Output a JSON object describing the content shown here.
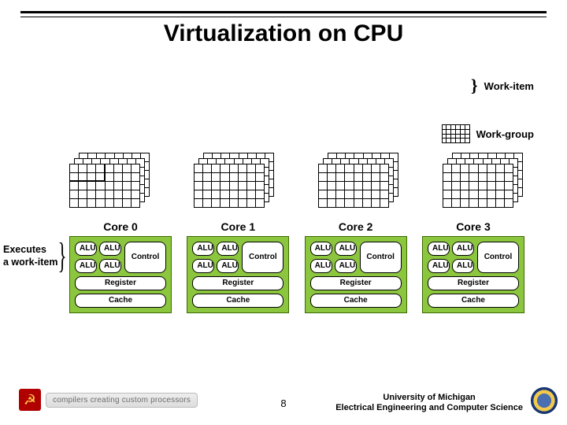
{
  "title": "Virtualization on CPU",
  "legend": {
    "work_item": "Work-item",
    "work_group": "Work-group"
  },
  "cores": [
    {
      "label": "Core 0",
      "alu": "ALU",
      "control": "Control",
      "register": "Register",
      "cache": "Cache"
    },
    {
      "label": "Core 1",
      "alu": "ALU",
      "control": "Control",
      "register": "Register",
      "cache": "Cache"
    },
    {
      "label": "Core 2",
      "alu": "ALU",
      "control": "Control",
      "register": "Register",
      "cache": "Cache"
    },
    {
      "label": "Core 3",
      "alu": "ALU",
      "control": "Control",
      "register": "Register",
      "cache": "Cache"
    }
  ],
  "side_annotation": {
    "line1": "Executes",
    "line2": "a work-item"
  },
  "footer": {
    "page": "8",
    "affiliation_line1": "University of Michigan",
    "affiliation_line2": "Electrical Engineering and Computer Science",
    "ccc_tag": "compilers creating custom processors"
  }
}
